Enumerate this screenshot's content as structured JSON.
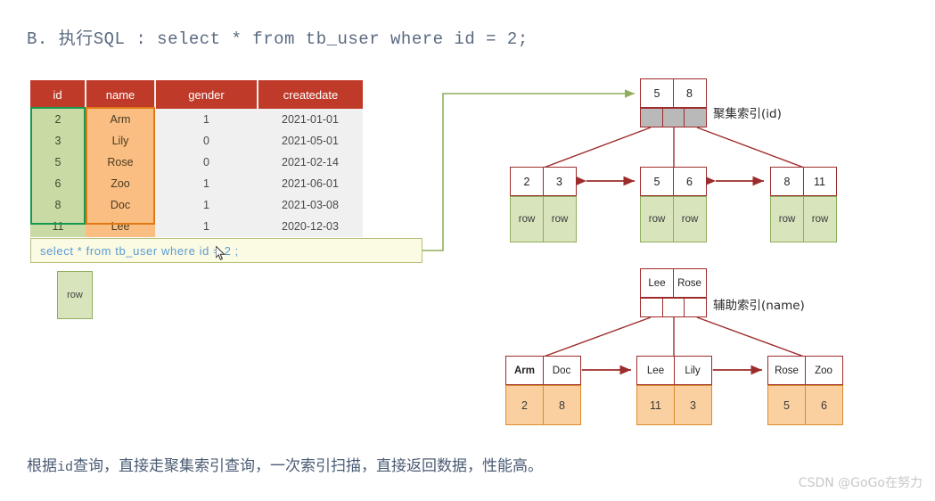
{
  "heading": {
    "prefix": "B. ",
    "cn": "执行",
    "sql_label": "SQL",
    "separator": " : ",
    "sql": "select * from tb_user where id = 2;"
  },
  "table": {
    "headers": [
      "id",
      "name",
      "gender",
      "createdate"
    ],
    "rows": [
      {
        "id": "2",
        "name": "Arm",
        "gender": "1",
        "createdate": "2021-01-01"
      },
      {
        "id": "3",
        "name": "Lily",
        "gender": "0",
        "createdate": "2021-05-01"
      },
      {
        "id": "5",
        "name": "Rose",
        "gender": "0",
        "createdate": "2021-02-14"
      },
      {
        "id": "6",
        "name": "Zoo",
        "gender": "1",
        "createdate": "2021-06-01"
      },
      {
        "id": "8",
        "name": "Doc",
        "gender": "1",
        "createdate": "2021-03-08"
      },
      {
        "id": "11",
        "name": "Lee",
        "gender": "1",
        "createdate": "2020-12-03"
      }
    ],
    "highlight_id_color": "#149a4e",
    "highlight_name_color": "#e07a16",
    "header_color": "#bf3a29"
  },
  "sql_input": {
    "value": "select * from  tb_user  where  id = 2 ;",
    "text_color": "#5b9bd5",
    "background": "#fbfae2"
  },
  "result_row": {
    "label": "row"
  },
  "clustered_index": {
    "label": "聚集索引(id)",
    "root": {
      "keys": [
        "5",
        "8"
      ],
      "pointers": 3,
      "pointer_fill": "#b9b9b9"
    },
    "leaves": [
      {
        "keys": [
          "2",
          "3"
        ],
        "data": [
          "row",
          "row"
        ]
      },
      {
        "keys": [
          "5",
          "6"
        ],
        "data": [
          "row",
          "row"
        ]
      },
      {
        "keys": [
          "8",
          "11"
        ],
        "data": [
          "row",
          "row"
        ]
      }
    ],
    "data_color": "#d7e4bc"
  },
  "secondary_index": {
    "label": "辅助索引(name)",
    "root": {
      "keys": [
        "Lee",
        "Rose"
      ],
      "pointers": 3,
      "pointer_fill": "#ffffff"
    },
    "leaves": [
      {
        "keys": [
          "Arm",
          "Doc"
        ],
        "data": [
          "2",
          "8"
        ]
      },
      {
        "keys": [
          "Lee",
          "Lily"
        ],
        "data": [
          "11",
          "3"
        ]
      },
      {
        "keys": [
          "Rose",
          "Zoo"
        ],
        "data": [
          "5",
          "6"
        ]
      }
    ],
    "data_color": "#fad0a0"
  },
  "footer": {
    "part1": "根据",
    "mono": "id",
    "part2": "查询，直接走聚集索引查询，一次索引扫描，直接返回数据，性能高。"
  },
  "watermark": "CSDN @GoGo在努力"
}
